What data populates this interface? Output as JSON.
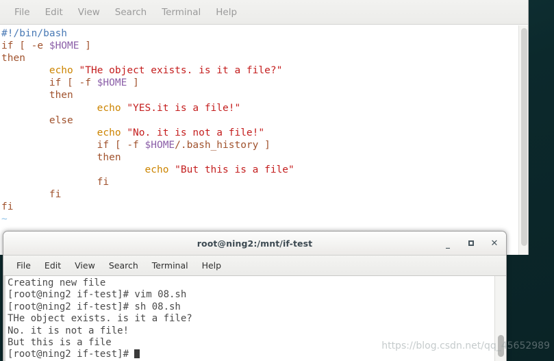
{
  "desktop": {
    "background_color": "#0d2b2e"
  },
  "vim_window": {
    "name": "vim-editor-window",
    "menubar": [
      {
        "label": "File"
      },
      {
        "label": "Edit"
      },
      {
        "label": "View"
      },
      {
        "label": "Search"
      },
      {
        "label": "Terminal"
      },
      {
        "label": "Help"
      }
    ],
    "scrollbar": {
      "name": "vertical-scrollbar"
    },
    "code_lines": [
      [
        {
          "t": "#!/bin/bash",
          "c": "shebang"
        }
      ],
      [
        {
          "t": "if [ -e ",
          "c": "kw"
        },
        {
          "t": "$HOME",
          "c": "var"
        },
        {
          "t": " ]",
          "c": "kw"
        }
      ],
      [
        {
          "t": "then",
          "c": "kw"
        }
      ],
      [
        {
          "t": "        echo ",
          "c": "cmd"
        },
        {
          "t": "\"THe object exists. is it a file?\"",
          "c": "str"
        }
      ],
      [
        {
          "t": "        if [ -f ",
          "c": "kw"
        },
        {
          "t": "$HOME",
          "c": "var"
        },
        {
          "t": " ]",
          "c": "kw"
        }
      ],
      [
        {
          "t": "        then",
          "c": "kw"
        }
      ],
      [
        {
          "t": "                echo ",
          "c": "cmd"
        },
        {
          "t": "\"YES.it is a file!\"",
          "c": "str"
        }
      ],
      [
        {
          "t": "        else",
          "c": "kw"
        }
      ],
      [
        {
          "t": "                echo ",
          "c": "cmd"
        },
        {
          "t": "\"No. it is not a file!\"",
          "c": "str"
        }
      ],
      [
        {
          "t": "                if [ -f ",
          "c": "kw"
        },
        {
          "t": "$HOME",
          "c": "var"
        },
        {
          "t": "/.bash_history ]",
          "c": "kw"
        }
      ],
      [
        {
          "t": "                then",
          "c": "kw"
        }
      ],
      [
        {
          "t": "                        echo ",
          "c": "cmd"
        },
        {
          "t": "\"But this is a file\"",
          "c": "str"
        }
      ],
      [
        {
          "t": "                fi",
          "c": "kw"
        }
      ],
      [
        {
          "t": "        fi",
          "c": "kw"
        }
      ],
      [
        {
          "t": "fi",
          "c": "kw"
        }
      ],
      [
        {
          "t": "~",
          "c": "tilde"
        }
      ]
    ]
  },
  "terminal_window": {
    "name": "terminal-window",
    "title": "root@ning2:/mnt/if-test",
    "window_buttons": {
      "minimize": "minimize-button",
      "maximize": "maximize-button",
      "close": "close-button"
    },
    "menubar": [
      {
        "label": "File"
      },
      {
        "label": "Edit"
      },
      {
        "label": "View"
      },
      {
        "label": "Search"
      },
      {
        "label": "Terminal"
      },
      {
        "label": "Help"
      }
    ],
    "scrollbar": {
      "name": "vertical-scrollbar"
    },
    "output_lines": [
      "Creating new file",
      "[root@ning2 if-test]# vim 08.sh",
      "[root@ning2 if-test]# sh 08.sh",
      "THe object exists. is it a file?",
      "No. it is not a file!",
      "But this is a file"
    ],
    "prompt": "[root@ning2 if-test]# "
  },
  "watermark": {
    "text": "https://blog.csdn.net/qq_45652989"
  }
}
